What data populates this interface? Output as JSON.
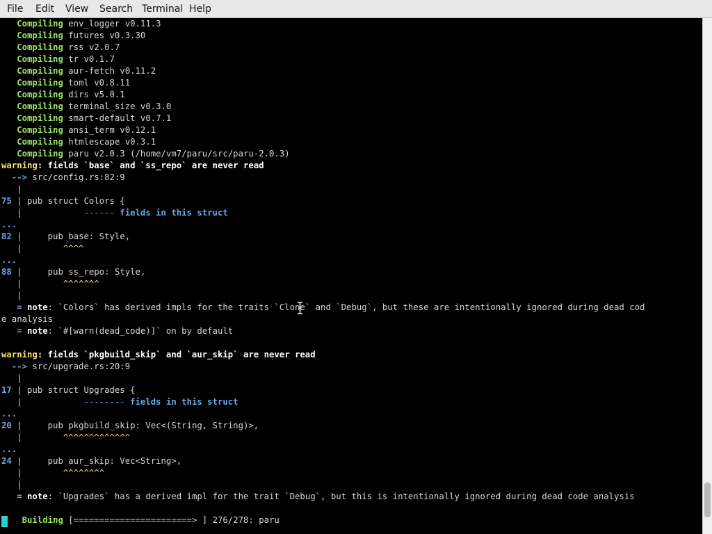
{
  "menu": [
    "File",
    "Edit",
    "View",
    "Search",
    "Terminal",
    "Help"
  ],
  "compiling_label": "Compiling",
  "compiling": [
    "env_logger v0.11.3",
    "futures v0.3.30",
    "rss v2.0.7",
    "tr v0.1.7",
    "aur-fetch v0.11.2",
    "toml v0.8.11",
    "dirs v5.0.1",
    "terminal_size v0.3.0",
    "smart-default v0.7.1",
    "ansi_term v0.12.1",
    "htmlescape v0.3.1",
    "paru v2.0.3 (/home/vm7/paru/src/paru-2.0.3)"
  ],
  "warning_label": "warning",
  "note_label": "note",
  "warning1": {
    "message": ": fields `base` and `ss_repo` are never read",
    "location": "src/config.rs:82:9",
    "struct_line_no": "75",
    "struct_code": "pub struct Colors {",
    "struct_underline": "------",
    "struct_label": "fields in this struct",
    "field1_line_no": "82",
    "field1_code": "    pub base: Style,",
    "field1_carets": "^^^^",
    "field2_line_no": "88",
    "field2_code": "    pub ss_repo: Style,",
    "field2_carets": "^^^^^^^",
    "note1_text": " `Colors` has derived impls for the traits `Clone` and `Debug`, but these are intentionally ignored during dead cod",
    "note1_wrap": "e analysis",
    "note2_text": " `#[warn(dead_code)]` on by default"
  },
  "warning2": {
    "message": ": fields `pkgbuild_skip` and `aur_skip` are never read",
    "location": "src/upgrade.rs:20:9",
    "struct_line_no": "17",
    "struct_code": "pub struct Upgrades {",
    "struct_underline": "--------",
    "struct_label": "fields in this struct",
    "field1_line_no": "20",
    "field1_code": "    pub pkgbuild_skip: Vec<(String, String)>,",
    "field1_carets": "^^^^^^^^^^^^^",
    "field2_line_no": "24",
    "field2_code": "    pub aur_skip: Vec<String>,",
    "field2_carets": "^^^^^^^^",
    "note_text": " `Upgrades` has a derived impl for the trait `Debug`, but this is intentionally ignored during dead code analysis"
  },
  "building": {
    "label": "Building",
    "bar": "[=======================> ]",
    "progress_text": "276/278: paru",
    "progress_fraction": 0.993
  },
  "colors": {
    "compiling_green": "#9be564",
    "warning_yellow": "#f4e36a",
    "gutter_blue": "#6da6e8",
    "cursor_cyan": "#2ad0d0"
  }
}
